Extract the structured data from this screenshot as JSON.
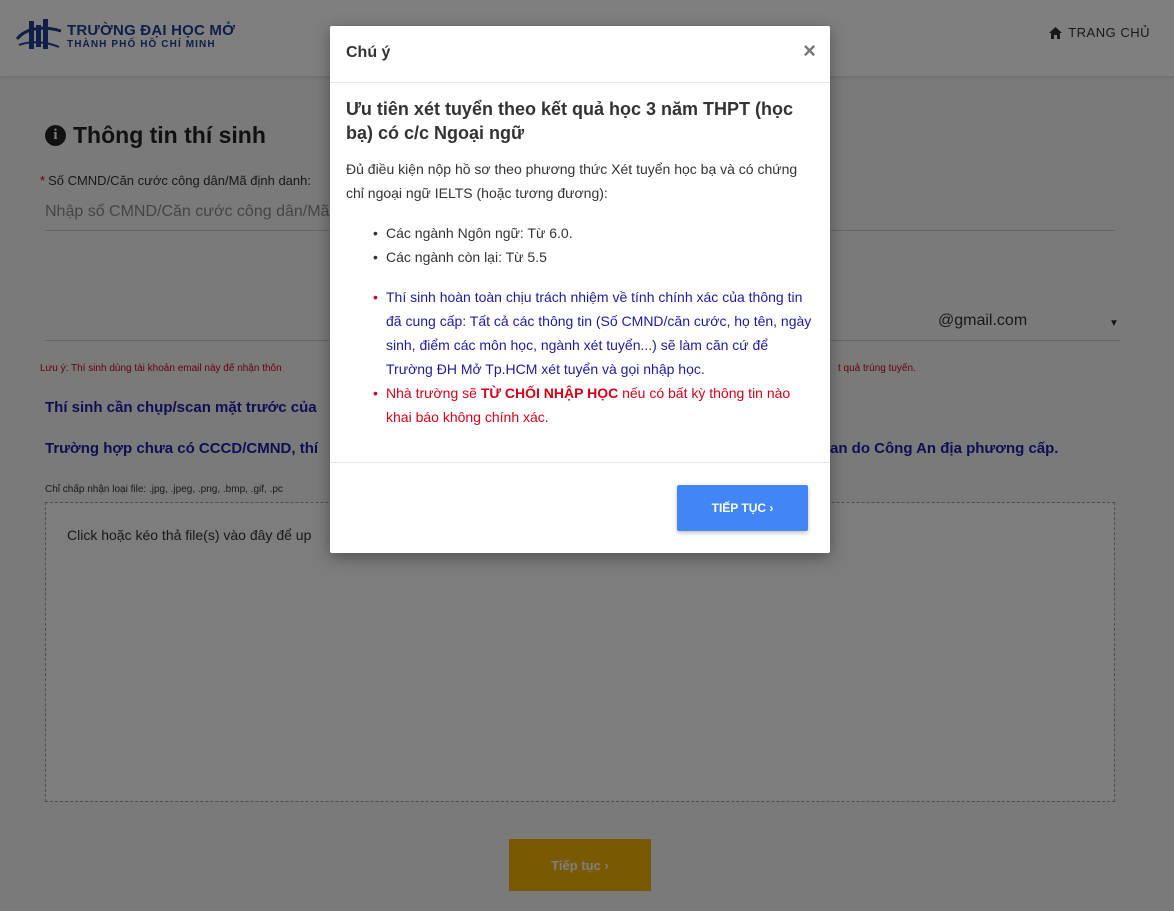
{
  "header": {
    "logo_title": "TRƯỜNG ĐẠI HỌC MỞ",
    "logo_subtitle": "THÀNH PHỐ HỒ CHÍ MINH",
    "home_label": "TRANG CHỦ",
    "home_icon": "home-icon"
  },
  "form": {
    "section_title": "Thông tin thí sinh",
    "section_icon": "info-circle-icon",
    "id_label_required": "*",
    "id_label": "Số CMND/Căn cước công dân/Mã định danh:",
    "id_placeholder": "Nhập số CMND/Căn cước công dân/Mã",
    "email_domain": "@gmail.com",
    "email_caret": "▼",
    "email_note": "Lưu ý: Thí sinh dùng tài khoản email này để nhận thôn",
    "email_note_tail": "t quả trúng tuyển.",
    "scan_notice": "Thí sinh cần chụp/scan mặt trước của",
    "no_id_notice": "Trường hợp chưa có CCCD/CMND, thí",
    "no_id_notice_tail": "an do Công An địa phương cấp.",
    "file_types": "Chỉ chấp nhận loại file: .jpg, .jpeg, .png, .bmp, .gif, .pc",
    "dropzone_text": "Click hoặc kéo thả file(s) vào đây để up",
    "continue_label": "Tiếp tục ›"
  },
  "modal": {
    "title": "Chú ý",
    "close_label": "×",
    "heading": "Ưu tiên xét tuyển theo kết quả học 3 năm THPT (học bạ) có c/c Ngoại ngữ",
    "intro": "Đủ điều kiện nộp hồ sơ theo phương thức Xét tuyển học bạ và có chứng chỉ ngoại ngữ IELTS (hoặc tương đương):",
    "requirements": [
      "Các ngành Ngôn ngữ: Từ 6.0.",
      "Các ngành còn lại: Từ 5.5"
    ],
    "warning_1": "Thí sinh hoàn toàn chịu trách nhiệm về tính chính xác của thông tin đã cung cấp: Tất cả các thông tin (Số CMND/căn cước, họ tên, ngày sinh, điểm các môn học, ngành xét tuyển...) sẽ làm căn cứ để Trường ĐH Mở Tp.HCM xét tuyển và gọi nhập học.",
    "warning_2_prefix": "Nhà trường sẽ ",
    "warning_2_bold": "TỪ CHỐI NHẬP HỌC",
    "warning_2_suffix": " nếu có bất kỳ thông tin nào khai báo không chính xác.",
    "continue_label": "TIẾP TỤC ›"
  },
  "colors": {
    "brand_blue": "#1f3f91",
    "notice_blue": "#1c1ca8",
    "warning_red": "#d0021b",
    "primary_button": "#4285f4",
    "accent_yellow": "#f3b400"
  }
}
